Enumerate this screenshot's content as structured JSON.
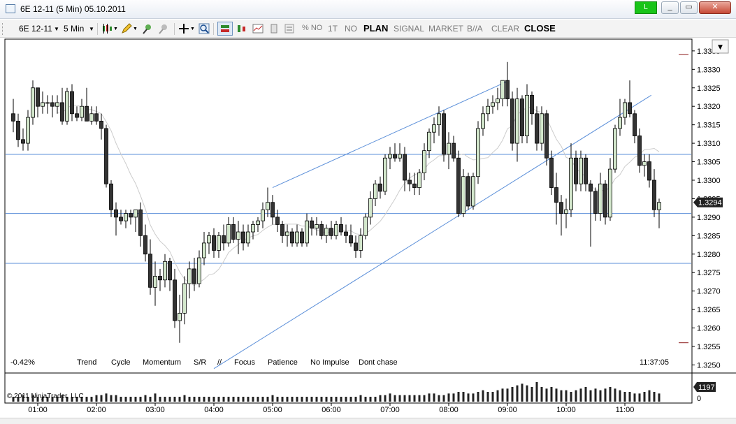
{
  "window": {
    "title": "6E 12-11 (5 Min)  05.10.2011",
    "connection_label": "L",
    "minimize_label": "_",
    "restore_label": "▭",
    "close_label": "✕"
  },
  "toolbar": {
    "instrument": "6E 12-11",
    "interval": "5 Min",
    "pct_no": "% NO",
    "t1": "1T",
    "no": "NO",
    "plan": "PLAN",
    "signal": "SIGNAL",
    "market": "MARKET",
    "ba": "B//A",
    "clear": "CLEAR",
    "close": "CLOSE"
  },
  "chart_overlay": {
    "pct_change": "-0.42%",
    "indicators": [
      "Trend",
      "Cycle",
      "Momentum",
      "S/R",
      "//",
      "Focus",
      "Patience",
      "No Impulse",
      "Dont chase"
    ],
    "clock": "11:37:05",
    "copyright": "© 2011 NinjaTrader, LLC",
    "price_marker": "1.3294",
    "volume_marker": "1197",
    "volume_zero_label": "0"
  },
  "colors": {
    "up_candle": "#d3e7cc",
    "down_candle": "#333333",
    "wick": "#000000",
    "trendline": "#5b8fd9",
    "sma": "#cccccc",
    "marker_bg": "#222222",
    "short_dash": "#8b1a1a"
  },
  "chart_data": {
    "type": "candlestick",
    "y_axis": {
      "range": [
        1.3248,
        1.3338
      ],
      "ticks": [
        "1.3250",
        "1.3255",
        "1.3260",
        "1.3265",
        "1.3270",
        "1.3275",
        "1.3280",
        "1.3285",
        "1.3290",
        "1.3295",
        "1.3300",
        "1.3305",
        "1.3310",
        "1.3315",
        "1.3320",
        "1.3325",
        "1.3330",
        "1.3335"
      ]
    },
    "x_axis": {
      "ticks": [
        "01:00",
        "02:00",
        "03:00",
        "04:00",
        "05:00",
        "06:00",
        "07:00",
        "08:00",
        "09:00",
        "10:00",
        "11:00"
      ]
    },
    "last_price": 1.3294,
    "horizontal_lines": [
      1.3307,
      1.3291,
      1.32775
    ],
    "channel_lines": [
      {
        "from": [
          "04:00",
          1.3249
        ],
        "to": [
          "11:27",
          1.3323
        ]
      },
      {
        "from": [
          "05:00",
          1.3298
        ],
        "to": [
          "09:02",
          1.3327
        ]
      }
    ],
    "short_marks": [
      1.3334,
      1.3256
    ],
    "bars": [
      {
        "t": "00:35",
        "o": 1.3318,
        "h": 1.3322,
        "l": 1.3313,
        "c": 1.3316
      },
      {
        "t": "00:40",
        "o": 1.3316,
        "h": 1.3318,
        "l": 1.3309,
        "c": 1.3311
      },
      {
        "t": "00:45",
        "o": 1.3311,
        "h": 1.3314,
        "l": 1.3308,
        "c": 1.331
      },
      {
        "t": "00:50",
        "o": 1.331,
        "h": 1.3319,
        "l": 1.3308,
        "c": 1.3317
      },
      {
        "t": "00:55",
        "o": 1.3317,
        "h": 1.3327,
        "l": 1.3315,
        "c": 1.3325
      },
      {
        "t": "01:00",
        "o": 1.3325,
        "h": 1.3325,
        "l": 1.3317,
        "c": 1.332
      },
      {
        "t": "01:05",
        "o": 1.332,
        "h": 1.3324,
        "l": 1.3318,
        "c": 1.3321
      },
      {
        "t": "01:10",
        "o": 1.3321,
        "h": 1.3323,
        "l": 1.3318,
        "c": 1.3321
      },
      {
        "t": "01:15",
        "o": 1.3321,
        "h": 1.3323,
        "l": 1.3317,
        "c": 1.332
      },
      {
        "t": "01:20",
        "o": 1.332,
        "h": 1.3323,
        "l": 1.3318,
        "c": 1.3321
      },
      {
        "t": "01:25",
        "o": 1.3321,
        "h": 1.3325,
        "l": 1.3315,
        "c": 1.3316
      },
      {
        "t": "01:30",
        "o": 1.3316,
        "h": 1.3325,
        "l": 1.3315,
        "c": 1.3324
      },
      {
        "t": "01:35",
        "o": 1.3324,
        "h": 1.3326,
        "l": 1.3316,
        "c": 1.3318
      },
      {
        "t": "01:40",
        "o": 1.3318,
        "h": 1.332,
        "l": 1.3316,
        "c": 1.3317
      },
      {
        "t": "01:45",
        "o": 1.3317,
        "h": 1.3322,
        "l": 1.3316,
        "c": 1.332
      },
      {
        "t": "01:50",
        "o": 1.332,
        "h": 1.3325,
        "l": 1.3316,
        "c": 1.3316
      },
      {
        "t": "01:55",
        "o": 1.3316,
        "h": 1.332,
        "l": 1.3315,
        "c": 1.3318
      },
      {
        "t": "02:00",
        "o": 1.3318,
        "h": 1.332,
        "l": 1.3315,
        "c": 1.3316
      },
      {
        "t": "02:05",
        "o": 1.3316,
        "h": 1.3318,
        "l": 1.3311,
        "c": 1.3314
      },
      {
        "t": "02:10",
        "o": 1.3314,
        "h": 1.3315,
        "l": 1.3298,
        "c": 1.3299
      },
      {
        "t": "02:15",
        "o": 1.3299,
        "h": 1.33,
        "l": 1.329,
        "c": 1.3292
      },
      {
        "t": "02:20",
        "o": 1.3292,
        "h": 1.3294,
        "l": 1.3285,
        "c": 1.329
      },
      {
        "t": "02:25",
        "o": 1.329,
        "h": 1.3292,
        "l": 1.3288,
        "c": 1.3289
      },
      {
        "t": "02:30",
        "o": 1.3289,
        "h": 1.3292,
        "l": 1.3287,
        "c": 1.3291
      },
      {
        "t": "02:35",
        "o": 1.3291,
        "h": 1.3292,
        "l": 1.3288,
        "c": 1.329
      },
      {
        "t": "02:40",
        "o": 1.329,
        "h": 1.3292,
        "l": 1.3286,
        "c": 1.3292
      },
      {
        "t": "02:45",
        "o": 1.3292,
        "h": 1.3294,
        "l": 1.3282,
        "c": 1.3285
      },
      {
        "t": "02:50",
        "o": 1.3285,
        "h": 1.3288,
        "l": 1.3278,
        "c": 1.328
      },
      {
        "t": "02:55",
        "o": 1.328,
        "h": 1.3284,
        "l": 1.3269,
        "c": 1.3271
      },
      {
        "t": "03:00",
        "o": 1.3271,
        "h": 1.3278,
        "l": 1.3266,
        "c": 1.3274
      },
      {
        "t": "03:05",
        "o": 1.3274,
        "h": 1.3276,
        "l": 1.327,
        "c": 1.3273
      },
      {
        "t": "03:10",
        "o": 1.3273,
        "h": 1.328,
        "l": 1.3271,
        "c": 1.3278
      },
      {
        "t": "03:15",
        "o": 1.3278,
        "h": 1.3279,
        "l": 1.327,
        "c": 1.3273
      },
      {
        "t": "03:20",
        "o": 1.3273,
        "h": 1.3276,
        "l": 1.326,
        "c": 1.3262
      },
      {
        "t": "03:25",
        "o": 1.3262,
        "h": 1.3269,
        "l": 1.3256,
        "c": 1.3264
      },
      {
        "t": "03:30",
        "o": 1.3264,
        "h": 1.3274,
        "l": 1.3261,
        "c": 1.3272
      },
      {
        "t": "03:35",
        "o": 1.3272,
        "h": 1.3278,
        "l": 1.3268,
        "c": 1.3276
      },
      {
        "t": "03:40",
        "o": 1.3276,
        "h": 1.3279,
        "l": 1.327,
        "c": 1.3272
      },
      {
        "t": "03:45",
        "o": 1.3272,
        "h": 1.3281,
        "l": 1.3271,
        "c": 1.3279
      },
      {
        "t": "03:50",
        "o": 1.3279,
        "h": 1.3286,
        "l": 1.3277,
        "c": 1.3283
      },
      {
        "t": "03:55",
        "o": 1.3283,
        "h": 1.3286,
        "l": 1.328,
        "c": 1.3285
      },
      {
        "t": "04:00",
        "o": 1.3285,
        "h": 1.3287,
        "l": 1.3279,
        "c": 1.3281
      },
      {
        "t": "04:05",
        "o": 1.3281,
        "h": 1.3286,
        "l": 1.3279,
        "c": 1.3285
      },
      {
        "t": "04:10",
        "o": 1.3285,
        "h": 1.3288,
        "l": 1.3281,
        "c": 1.3283
      },
      {
        "t": "04:15",
        "o": 1.3283,
        "h": 1.329,
        "l": 1.3282,
        "c": 1.3288
      },
      {
        "t": "04:20",
        "o": 1.3288,
        "h": 1.329,
        "l": 1.3283,
        "c": 1.3284
      },
      {
        "t": "04:25",
        "o": 1.3284,
        "h": 1.3289,
        "l": 1.328,
        "c": 1.3286
      },
      {
        "t": "04:30",
        "o": 1.3286,
        "h": 1.3288,
        "l": 1.3281,
        "c": 1.3283
      },
      {
        "t": "04:35",
        "o": 1.3283,
        "h": 1.3288,
        "l": 1.3282,
        "c": 1.3286
      },
      {
        "t": "04:40",
        "o": 1.3286,
        "h": 1.3289,
        "l": 1.3284,
        "c": 1.3288
      },
      {
        "t": "04:45",
        "o": 1.3288,
        "h": 1.329,
        "l": 1.3286,
        "c": 1.3289
      },
      {
        "t": "04:50",
        "o": 1.3289,
        "h": 1.3294,
        "l": 1.3287,
        "c": 1.3292
      },
      {
        "t": "04:55",
        "o": 1.3292,
        "h": 1.3298,
        "l": 1.329,
        "c": 1.3294
      },
      {
        "t": "05:00",
        "o": 1.3294,
        "h": 1.3296,
        "l": 1.3288,
        "c": 1.329
      },
      {
        "t": "05:05",
        "o": 1.329,
        "h": 1.3292,
        "l": 1.3286,
        "c": 1.3288
      },
      {
        "t": "05:10",
        "o": 1.3288,
        "h": 1.3289,
        "l": 1.3283,
        "c": 1.3285
      },
      {
        "t": "05:15",
        "o": 1.3285,
        "h": 1.3288,
        "l": 1.3282,
        "c": 1.3286
      },
      {
        "t": "05:20",
        "o": 1.3286,
        "h": 1.3287,
        "l": 1.3282,
        "c": 1.3283
      },
      {
        "t": "05:25",
        "o": 1.3283,
        "h": 1.3288,
        "l": 1.3282,
        "c": 1.3286
      },
      {
        "t": "05:30",
        "o": 1.3286,
        "h": 1.3287,
        "l": 1.3282,
        "c": 1.3283
      },
      {
        "t": "05:35",
        "o": 1.3283,
        "h": 1.3291,
        "l": 1.3282,
        "c": 1.3289
      },
      {
        "t": "05:40",
        "o": 1.3289,
        "h": 1.329,
        "l": 1.3285,
        "c": 1.3287
      },
      {
        "t": "05:45",
        "o": 1.3287,
        "h": 1.329,
        "l": 1.3285,
        "c": 1.3288
      },
      {
        "t": "05:50",
        "o": 1.3288,
        "h": 1.3289,
        "l": 1.3284,
        "c": 1.3285
      },
      {
        "t": "05:55",
        "o": 1.3285,
        "h": 1.3288,
        "l": 1.3283,
        "c": 1.3287
      },
      {
        "t": "06:00",
        "o": 1.3287,
        "h": 1.3289,
        "l": 1.3284,
        "c": 1.3285
      },
      {
        "t": "06:05",
        "o": 1.3285,
        "h": 1.3289,
        "l": 1.3284,
        "c": 1.3288
      },
      {
        "t": "06:10",
        "o": 1.3288,
        "h": 1.329,
        "l": 1.3285,
        "c": 1.3286
      },
      {
        "t": "06:15",
        "o": 1.3286,
        "h": 1.3288,
        "l": 1.3283,
        "c": 1.3285
      },
      {
        "t": "06:20",
        "o": 1.3285,
        "h": 1.3288,
        "l": 1.3282,
        "c": 1.3283
      },
      {
        "t": "06:25",
        "o": 1.3283,
        "h": 1.3285,
        "l": 1.3279,
        "c": 1.3281
      },
      {
        "t": "06:30",
        "o": 1.3281,
        "h": 1.3287,
        "l": 1.3279,
        "c": 1.3285
      },
      {
        "t": "06:35",
        "o": 1.3285,
        "h": 1.3291,
        "l": 1.3284,
        "c": 1.329
      },
      {
        "t": "06:40",
        "o": 1.329,
        "h": 1.3297,
        "l": 1.3288,
        "c": 1.3295
      },
      {
        "t": "06:45",
        "o": 1.3295,
        "h": 1.33,
        "l": 1.3293,
        "c": 1.3299
      },
      {
        "t": "06:50",
        "o": 1.3299,
        "h": 1.3301,
        "l": 1.3295,
        "c": 1.3297
      },
      {
        "t": "06:55",
        "o": 1.3297,
        "h": 1.3307,
        "l": 1.3296,
        "c": 1.3306
      },
      {
        "t": "07:00",
        "o": 1.3306,
        "h": 1.3309,
        "l": 1.3303,
        "c": 1.3307
      },
      {
        "t": "07:05",
        "o": 1.3307,
        "h": 1.331,
        "l": 1.3305,
        "c": 1.3306
      },
      {
        "t": "07:10",
        "o": 1.3306,
        "h": 1.331,
        "l": 1.3305,
        "c": 1.3307
      },
      {
        "t": "07:15",
        "o": 1.3307,
        "h": 1.3309,
        "l": 1.3297,
        "c": 1.33
      },
      {
        "t": "07:20",
        "o": 1.33,
        "h": 1.3302,
        "l": 1.3297,
        "c": 1.3299
      },
      {
        "t": "07:25",
        "o": 1.3299,
        "h": 1.3302,
        "l": 1.3296,
        "c": 1.3298
      },
      {
        "t": "07:30",
        "o": 1.3298,
        "h": 1.3303,
        "l": 1.3296,
        "c": 1.3302
      },
      {
        "t": "07:35",
        "o": 1.3302,
        "h": 1.331,
        "l": 1.33,
        "c": 1.3308
      },
      {
        "t": "07:40",
        "o": 1.3308,
        "h": 1.3314,
        "l": 1.3306,
        "c": 1.3313
      },
      {
        "t": "07:45",
        "o": 1.3313,
        "h": 1.3317,
        "l": 1.331,
        "c": 1.3315
      },
      {
        "t": "07:50",
        "o": 1.3315,
        "h": 1.332,
        "l": 1.3312,
        "c": 1.3318
      },
      {
        "t": "07:55",
        "o": 1.3318,
        "h": 1.3319,
        "l": 1.3305,
        "c": 1.3307
      },
      {
        "t": "08:00",
        "o": 1.3307,
        "h": 1.3313,
        "l": 1.3303,
        "c": 1.331
      },
      {
        "t": "08:05",
        "o": 1.331,
        "h": 1.3312,
        "l": 1.3305,
        "c": 1.3306
      },
      {
        "t": "08:10",
        "o": 1.3306,
        "h": 1.3308,
        "l": 1.329,
        "c": 1.3291
      },
      {
        "t": "08:15",
        "o": 1.3291,
        "h": 1.3303,
        "l": 1.329,
        "c": 1.3301
      },
      {
        "t": "08:20",
        "o": 1.3301,
        "h": 1.3302,
        "l": 1.3292,
        "c": 1.3293
      },
      {
        "t": "08:25",
        "o": 1.3293,
        "h": 1.3302,
        "l": 1.3292,
        "c": 1.3301
      },
      {
        "t": "08:30",
        "o": 1.3301,
        "h": 1.3316,
        "l": 1.3299,
        "c": 1.3314
      },
      {
        "t": "08:35",
        "o": 1.3314,
        "h": 1.332,
        "l": 1.3312,
        "c": 1.3318
      },
      {
        "t": "08:40",
        "o": 1.3318,
        "h": 1.3322,
        "l": 1.3316,
        "c": 1.332
      },
      {
        "t": "08:45",
        "o": 1.332,
        "h": 1.3323,
        "l": 1.3318,
        "c": 1.3321
      },
      {
        "t": "08:50",
        "o": 1.3321,
        "h": 1.3325,
        "l": 1.3319,
        "c": 1.3322
      },
      {
        "t": "08:55",
        "o": 1.3322,
        "h": 1.3327,
        "l": 1.332,
        "c": 1.3327
      },
      {
        "t": "09:00",
        "o": 1.3327,
        "h": 1.3332,
        "l": 1.332,
        "c": 1.3322
      },
      {
        "t": "09:05",
        "o": 1.3322,
        "h": 1.3324,
        "l": 1.3308,
        "c": 1.331
      },
      {
        "t": "09:10",
        "o": 1.331,
        "h": 1.3325,
        "l": 1.3305,
        "c": 1.3322
      },
      {
        "t": "09:15",
        "o": 1.3322,
        "h": 1.3323,
        "l": 1.331,
        "c": 1.3312
      },
      {
        "t": "09:20",
        "o": 1.3312,
        "h": 1.3326,
        "l": 1.331,
        "c": 1.3323
      },
      {
        "t": "09:25",
        "o": 1.3323,
        "h": 1.3324,
        "l": 1.3315,
        "c": 1.3318
      },
      {
        "t": "09:30",
        "o": 1.3318,
        "h": 1.332,
        "l": 1.3308,
        "c": 1.331
      },
      {
        "t": "09:35",
        "o": 1.331,
        "h": 1.332,
        "l": 1.3308,
        "c": 1.3318
      },
      {
        "t": "09:40",
        "o": 1.3318,
        "h": 1.3319,
        "l": 1.3304,
        "c": 1.3306
      },
      {
        "t": "09:45",
        "o": 1.3306,
        "h": 1.3308,
        "l": 1.3296,
        "c": 1.3298
      },
      {
        "t": "09:50",
        "o": 1.3298,
        "h": 1.3302,
        "l": 1.3288,
        "c": 1.3294
      },
      {
        "t": "09:55",
        "o": 1.3294,
        "h": 1.3296,
        "l": 1.3285,
        "c": 1.3291
      },
      {
        "t": "10:00",
        "o": 1.3291,
        "h": 1.3295,
        "l": 1.3287,
        "c": 1.3292
      },
      {
        "t": "10:05",
        "o": 1.3292,
        "h": 1.331,
        "l": 1.329,
        "c": 1.3306
      },
      {
        "t": "10:10",
        "o": 1.3306,
        "h": 1.3308,
        "l": 1.3297,
        "c": 1.3299
      },
      {
        "t": "10:15",
        "o": 1.3299,
        "h": 1.3308,
        "l": 1.3297,
        "c": 1.3306
      },
      {
        "t": "10:20",
        "o": 1.3306,
        "h": 1.3307,
        "l": 1.3297,
        "c": 1.3299
      },
      {
        "t": "10:25",
        "o": 1.3299,
        "h": 1.33,
        "l": 1.3282,
        "c": 1.3297
      },
      {
        "t": "10:30",
        "o": 1.3297,
        "h": 1.3298,
        "l": 1.3289,
        "c": 1.3291
      },
      {
        "t": "10:35",
        "o": 1.3291,
        "h": 1.3302,
        "l": 1.3289,
        "c": 1.3299
      },
      {
        "t": "10:40",
        "o": 1.3299,
        "h": 1.33,
        "l": 1.3288,
        "c": 1.329
      },
      {
        "t": "10:45",
        "o": 1.329,
        "h": 1.3306,
        "l": 1.3289,
        "c": 1.3303
      },
      {
        "t": "10:50",
        "o": 1.3303,
        "h": 1.3315,
        "l": 1.3302,
        "c": 1.3314
      },
      {
        "t": "10:55",
        "o": 1.3314,
        "h": 1.3322,
        "l": 1.3312,
        "c": 1.3317
      },
      {
        "t": "11:00",
        "o": 1.3317,
        "h": 1.3322,
        "l": 1.3315,
        "c": 1.3321
      },
      {
        "t": "11:05",
        "o": 1.3321,
        "h": 1.3327,
        "l": 1.3317,
        "c": 1.3318
      },
      {
        "t": "11:10",
        "o": 1.3318,
        "h": 1.3319,
        "l": 1.331,
        "c": 1.3312
      },
      {
        "t": "11:15",
        "o": 1.3312,
        "h": 1.3314,
        "l": 1.3302,
        "c": 1.3304
      },
      {
        "t": "11:20",
        "o": 1.3304,
        "h": 1.3307,
        "l": 1.3301,
        "c": 1.3305
      },
      {
        "t": "11:25",
        "o": 1.3305,
        "h": 1.3307,
        "l": 1.3298,
        "c": 1.33
      },
      {
        "t": "11:30",
        "o": 1.33,
        "h": 1.3303,
        "l": 1.329,
        "c": 1.3292
      },
      {
        "t": "11:35",
        "o": 1.3292,
        "h": 1.3295,
        "l": 1.3287,
        "c": 1.3294
      }
    ],
    "volume": [
      3,
      3,
      4,
      3,
      4,
      3,
      3,
      3,
      3,
      3,
      4,
      3,
      3,
      3,
      3,
      3,
      3,
      4,
      4,
      5,
      4,
      4,
      3,
      3,
      3,
      3,
      3,
      4,
      3,
      5,
      3,
      3,
      3,
      3,
      3,
      4,
      3,
      3,
      3,
      3,
      3,
      3,
      3,
      3,
      3,
      3,
      3,
      3,
      3,
      3,
      3,
      3,
      3,
      4,
      3,
      3,
      3,
      3,
      3,
      3,
      3,
      3,
      3,
      3,
      3,
      3,
      3,
      3,
      3,
      3,
      3,
      4,
      3,
      3,
      3,
      4,
      4,
      5,
      4,
      4,
      4,
      4,
      4,
      4,
      4,
      5,
      5,
      4,
      4,
      5,
      5,
      6,
      6,
      5,
      5,
      6,
      7,
      6,
      6,
      7,
      8,
      8,
      9,
      10,
      11,
      10,
      9,
      12,
      9,
      8,
      9,
      8,
      7,
      7,
      6,
      7,
      8,
      9,
      7,
      8,
      7,
      8,
      9,
      8,
      7,
      6,
      6,
      5,
      5,
      6,
      7,
      6,
      5,
      6,
      7,
      8,
      7,
      6
    ]
  }
}
